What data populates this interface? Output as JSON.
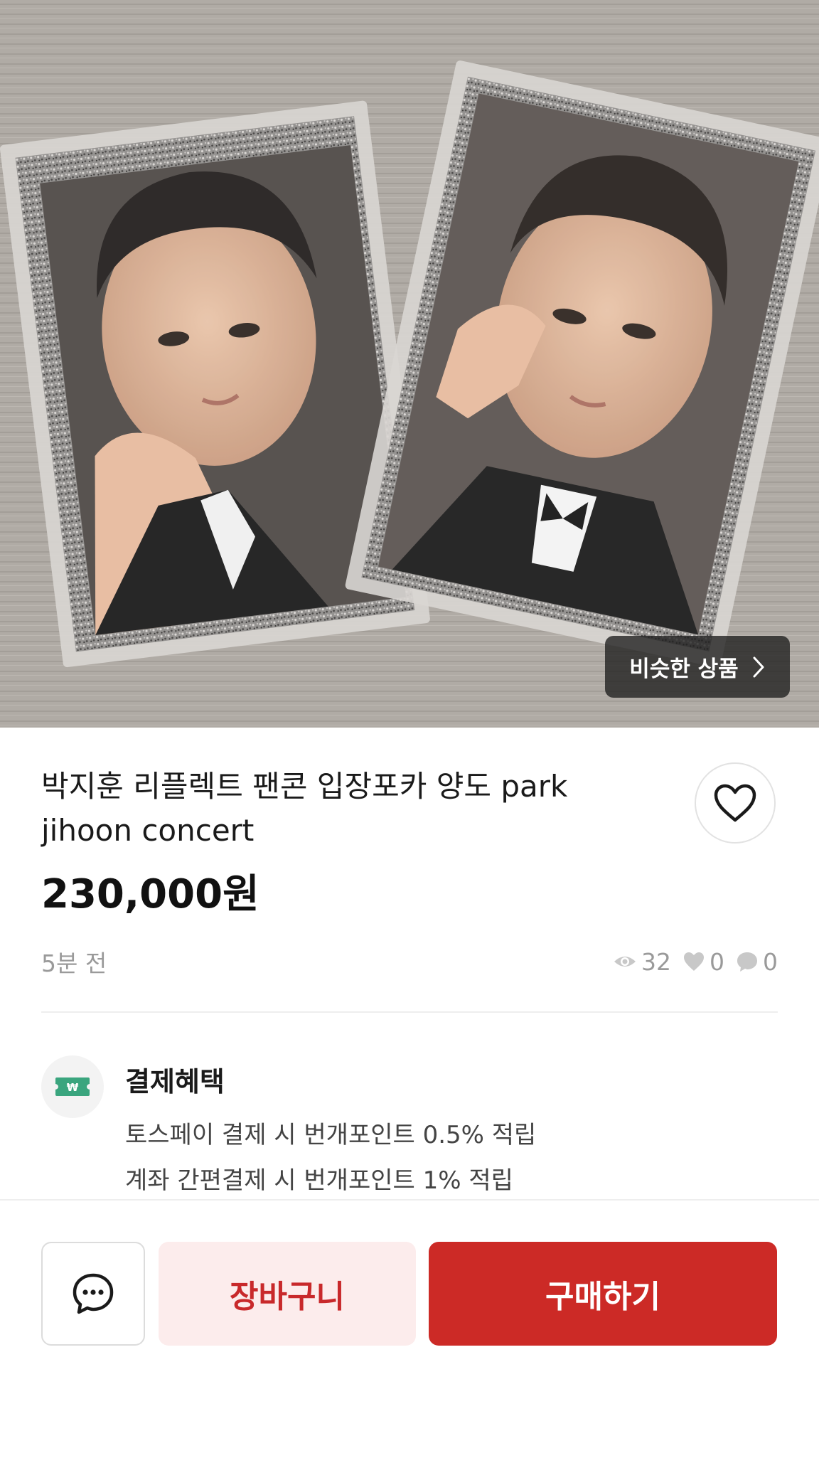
{
  "hero": {
    "similar_label": "비슷한 상품",
    "chevron_icon": "chevron-right-icon"
  },
  "product": {
    "title": "박지훈 리플렉트 팬콘 입장포카 양도 park jihoon concert",
    "price": "230,000원",
    "posted": "5분 전",
    "views": "32",
    "likes": "0",
    "chats": "0"
  },
  "benefit": {
    "title": "결제혜택",
    "line1": "토스페이 결제 시 번개포인트 0.5% 적립",
    "line2": "계좌 간편결제 시 번개포인트 1% 적립",
    "icon_color": "#3aa57e"
  },
  "actions": {
    "cart_label": "장바구니",
    "buy_label": "구매하기"
  },
  "colors": {
    "accent": "#cc2a26",
    "accent_soft": "#fcecec",
    "muted": "#9a9a9a"
  }
}
